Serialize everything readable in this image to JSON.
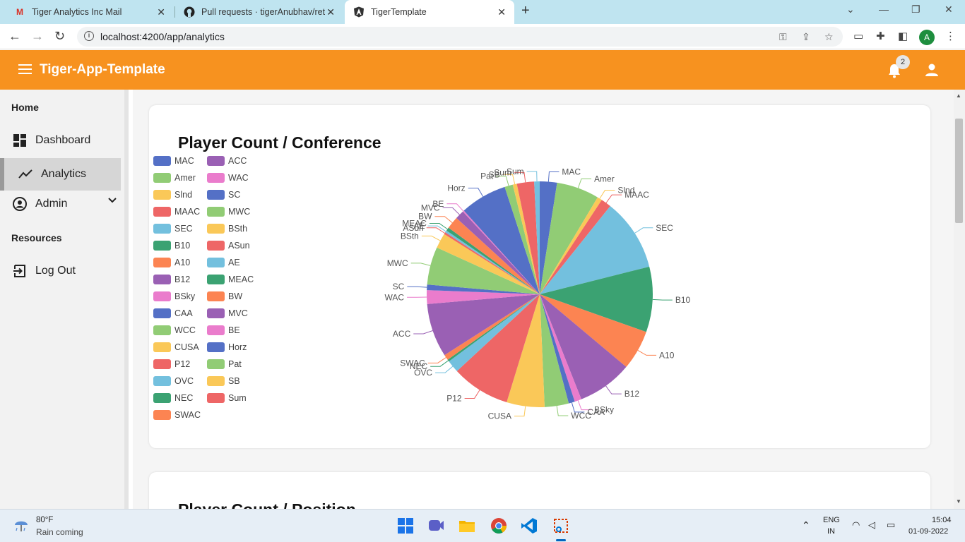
{
  "browser": {
    "tabs": [
      {
        "title": "Tiger Analytics Inc Mail",
        "icon": "gmail-icon"
      },
      {
        "title": "Pull requests · tigerAnubhav/reta",
        "icon": "github-icon"
      },
      {
        "title": "TigerTemplate",
        "icon": "angular-icon"
      }
    ],
    "url": "localhost:4200/app/analytics",
    "profile_initial": "A"
  },
  "header": {
    "title": "Tiger-App-Template",
    "notification_count": "2"
  },
  "sidebar": {
    "home_label": "Home",
    "items": [
      {
        "label": "Dashboard",
        "icon": "dashboard-icon"
      },
      {
        "label": "Analytics",
        "icon": "analytics-icon"
      },
      {
        "label": "Admin",
        "icon": "admin-icon"
      }
    ],
    "resources_label": "Resources",
    "logout_label": "Log Out"
  },
  "cards": {
    "conference_title": "Player Count / Conference",
    "position_title": "Player Count / Position"
  },
  "chart_data": {
    "type": "pie",
    "title": "Player Count / Conference",
    "legend_position": "left",
    "palette": [
      "#5470c6",
      "#91cc75",
      "#fac858",
      "#ee6666",
      "#73c0de",
      "#3ba272",
      "#fc8452",
      "#9a60b4",
      "#ea7ccc"
    ],
    "slices": [
      {
        "name": "MAC",
        "value": 2.5
      },
      {
        "name": "Amer",
        "value": 6.2
      },
      {
        "name": "Slnd",
        "value": 0.7
      },
      {
        "name": "MAAC",
        "value": 1.5
      },
      {
        "name": "SEC",
        "value": 10.5
      },
      {
        "name": "B10",
        "value": 9.5
      },
      {
        "name": "A10",
        "value": 5.8
      },
      {
        "name": "B12",
        "value": 8.0
      },
      {
        "name": "BSky",
        "value": 1.0
      },
      {
        "name": "CAA",
        "value": 0.9
      },
      {
        "name": "WCC",
        "value": 3.5
      },
      {
        "name": "CUSA",
        "value": 5.5
      },
      {
        "name": "P12",
        "value": 8.5
      },
      {
        "name": "OVC",
        "value": 1.8
      },
      {
        "name": "NEC",
        "value": 0.3
      },
      {
        "name": "SWAC",
        "value": 0.8
      },
      {
        "name": "ACC",
        "value": 7.8
      },
      {
        "name": "WAC",
        "value": 2.0
      },
      {
        "name": "SC",
        "value": 0.8
      },
      {
        "name": "MWC",
        "value": 5.5
      },
      {
        "name": "BSth",
        "value": 2.2
      },
      {
        "name": "ASun",
        "value": 0.3
      },
      {
        "name": "AE",
        "value": 0.3
      },
      {
        "name": "MEAC",
        "value": 0.5
      },
      {
        "name": "BW",
        "value": 1.8
      },
      {
        "name": "MVC",
        "value": 1.3
      },
      {
        "name": "BE",
        "value": 0.2
      },
      {
        "name": "Horz",
        "value": 6.8
      },
      {
        "name": "Pat",
        "value": 1.2
      },
      {
        "name": "SB",
        "value": 0.6
      },
      {
        "name": "Sum",
        "value": 2.5
      },
      {
        "name": "Sum",
        "value": 0.8
      }
    ]
  },
  "taskbar": {
    "temperature": "80°F",
    "weather": "Rain coming",
    "lang1": "ENG",
    "lang2": "IN",
    "time": "15:04",
    "date": "01-09-2022"
  }
}
